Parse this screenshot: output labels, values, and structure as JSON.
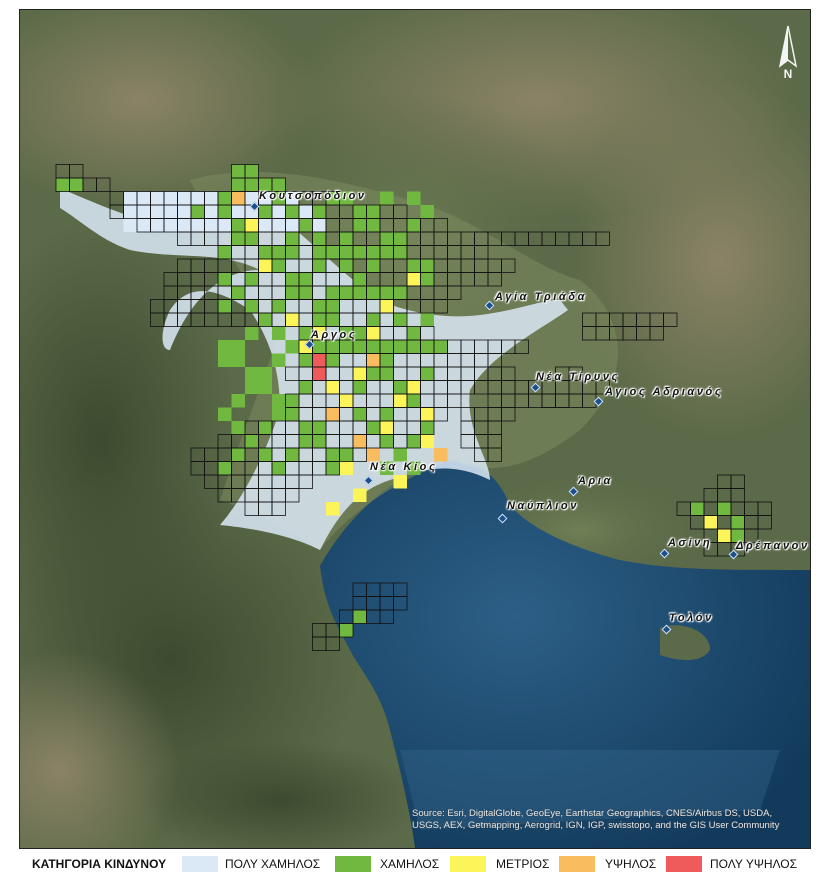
{
  "map": {
    "attribution": "Source: Esri, DigitalGlobe, GeoEye, Earthstar Geographics, CNES/Airbus DS, USDA, USGS, AEX, Getmapping, Aerogrid, IGN, IGP, swisstopo, and the GIS User Community",
    "north_arrow_label": "N",
    "places": [
      {
        "name": "Κουτσοπόδιον",
        "id": "koutsopodion"
      },
      {
        "name": "Αγία Τριάδα",
        "id": "agia-triada"
      },
      {
        "name": "Άργος",
        "id": "argos"
      },
      {
        "name": "Νέα Τίρυνς",
        "id": "nea-tiryns"
      },
      {
        "name": "Άγιος Αδριανός",
        "id": "agios-adrianos"
      },
      {
        "name": "Νέα Κίος",
        "id": "nea-kios"
      },
      {
        "name": "Άρια",
        "id": "aria"
      },
      {
        "name": "Ναύπλιον",
        "id": "nafplion"
      },
      {
        "name": "Ασίνη",
        "id": "asini"
      },
      {
        "name": "Δρέπανον",
        "id": "drepanon"
      },
      {
        "name": "Τολόν",
        "id": "tolon"
      }
    ]
  },
  "legend": {
    "title": "ΚΑΤΗΓΟΡΙΑ ΚΙΝΔΥΝΟΥ",
    "categories": [
      {
        "label": "ΠΟΛΥ ΧΑΜΗΛΟΣ",
        "color": "#dbe9f7"
      },
      {
        "label": "ΧΑΜΗΛΟΣ",
        "color": "#70b83f"
      },
      {
        "label": "ΜΕΤΡΙΟΣ",
        "color": "#fbf55a"
      },
      {
        "label": "ΥΨΗΛΟΣ",
        "color": "#f9bd5f"
      },
      {
        "label": "ΠΟΛΥ ΥΨΗΛΟΣ",
        "color": "#ef5a5a"
      }
    ]
  }
}
